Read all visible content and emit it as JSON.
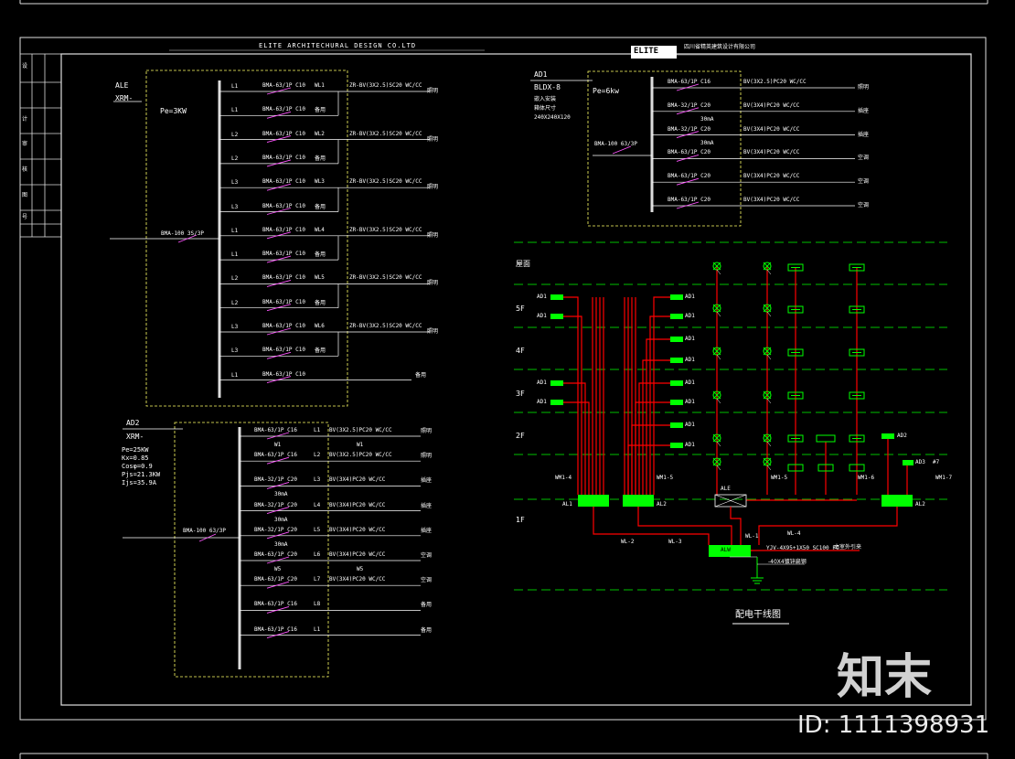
{
  "header": {
    "company_en": "ELITE  ARCHITECHURAL      DESIGN   CO.LTD",
    "logo": "ELITE",
    "company_cn": "四川省精英建筑设计有限公司"
  },
  "title_block": {
    "marks": [
      "设",
      "计",
      "审",
      "核",
      "图",
      "号"
    ]
  },
  "panel_ale": {
    "name": "ALE",
    "model": "XRM-",
    "pe": "Pe=3KW",
    "incoming": "BMA-100 3S/3P",
    "circuits": [
      {
        "phase": "L1",
        "breaker": "BMA-63/1P C10",
        "code": "WL1",
        "cable": "ZR-BV(3X2.5)SC20 WC/CC",
        "load": "照明"
      },
      {
        "phase": "L1",
        "breaker": "BMA-63/1P C10",
        "code": "",
        "cable": "",
        "load": "备用"
      },
      {
        "phase": "L2",
        "breaker": "BMA-63/1P C10",
        "code": "WL2",
        "cable": "ZR-BV(3X2.5)SC20 WC/CC",
        "load": "照明"
      },
      {
        "phase": "L2",
        "breaker": "BMA-63/1P C10",
        "code": "",
        "cable": "",
        "load": "备用"
      },
      {
        "phase": "L3",
        "breaker": "BMA-63/1P C10",
        "code": "WL3",
        "cable": "ZR-BV(3X2.5)SC20 WC/CC",
        "load": "照明"
      },
      {
        "phase": "L3",
        "breaker": "BMA-63/1P C10",
        "code": "",
        "cable": "",
        "load": "备用"
      },
      {
        "phase": "L1",
        "breaker": "BMA-63/1P C10",
        "code": "WL4",
        "cable": "ZR-BV(3X2.5)SC20 WC/CC",
        "load": "照明"
      },
      {
        "phase": "L1",
        "breaker": "BMA-63/1P C10",
        "code": "",
        "cable": "",
        "load": "备用"
      },
      {
        "phase": "L2",
        "breaker": "BMA-63/1P C10",
        "code": "WL5",
        "cable": "ZR-BV(3X2.5)SC20 WC/CC",
        "load": "照明"
      },
      {
        "phase": "L2",
        "breaker": "BMA-63/1P C10",
        "code": "",
        "cable": "",
        "load": "备用"
      },
      {
        "phase": "L3",
        "breaker": "BMA-63/1P C10",
        "code": "WL6",
        "cable": "ZR-BV(3X2.5)SC20 WC/CC",
        "load": "照明"
      },
      {
        "phase": "L3",
        "breaker": "BMA-63/1P C10",
        "code": "",
        "cable": "",
        "load": "备用"
      },
      {
        "phase": "L1",
        "breaker": "BMA-63/1P C10",
        "code": "",
        "cable": "",
        "load": "备用"
      }
    ]
  },
  "panel_ad2": {
    "name": "AD2",
    "model": "XRM-",
    "params": [
      "Pe=25KW",
      "Kx=0.85",
      "Cosφ=0.9",
      "Pjs=21.3KW",
      "Ijs=35.9A"
    ],
    "incoming": "BMA-100 63/3P",
    "circuits": [
      {
        "breaker": "BMA-63/1P C16",
        "phase": "L1",
        "cable": "BV(3X2.5)PC20 WC/CC",
        "load": "照明",
        "note": "W1",
        "note2": "W1"
      },
      {
        "breaker": "BMA-63/1P C16",
        "phase": "L2",
        "cable": "BV(3X2.5)PC20 WC/CC",
        "load": "照明",
        "note": "",
        "note2": ""
      },
      {
        "breaker": "BMA-32/1P C20",
        "phase": "L3",
        "cable": "BV(3X4)PC20 WC/CC",
        "load": "插座",
        "note": "30mA",
        "note2": ""
      },
      {
        "breaker": "BMA-32/1P C20",
        "phase": "L4",
        "cable": "BV(3X4)PC20 WC/CC",
        "load": "插座",
        "note": "30mA",
        "note2": ""
      },
      {
        "breaker": "BMA-32/1P C20",
        "phase": "L5",
        "cable": "BV(3X4)PC20 WC/CC",
        "load": "插座",
        "note": "30mA",
        "note2": ""
      },
      {
        "breaker": "BMA-63/1P C20",
        "phase": "L6",
        "cable": "BV(3X4)PC20 WC/CC",
        "load": "空调",
        "note": "W5",
        "note2": "W5"
      },
      {
        "breaker": "BMA-63/1P C20",
        "phase": "L7",
        "cable": "BV(3X4)PC20 WC/CC",
        "load": "空调",
        "note": "",
        "note2": ""
      },
      {
        "breaker": "BMA-63/1P C16",
        "phase": "L8",
        "cable": "",
        "load": "备用",
        "note": "",
        "note2": ""
      },
      {
        "breaker": "BMA-63/1P C16",
        "phase": "L1",
        "cable": "",
        "load": "备用",
        "note": "",
        "note2": ""
      }
    ]
  },
  "panel_ad1": {
    "name": "AD1",
    "model": "BLDX-8",
    "info": [
      "嵌入安装",
      "箱体尺寸",
      "240X240X120"
    ],
    "pe": "Pe=6kw",
    "incoming": "BMA-100 63/3P",
    "circuits": [
      {
        "breaker": "BMA-63/1P C16",
        "note": "",
        "cable": "BV(3X2.5)PC20 WC/CC",
        "load": "照明"
      },
      {
        "breaker": "BMA-32/1P C20",
        "note": "30mA",
        "cable": "BV(3X4)PC20 WC/CC",
        "load": "插座"
      },
      {
        "breaker": "BMA-32/1P C20",
        "note": "30mA",
        "cable": "BV(3X4)PC20 WC/CC",
        "load": "插座"
      },
      {
        "breaker": "BMA-63/1P C20",
        "note": "",
        "cable": "BV(3X4)PC20 WC/CC",
        "load": "空调"
      },
      {
        "breaker": "BMA-63/1P C20",
        "note": "",
        "cable": "BV(3X4)PC20 WC/CC",
        "load": "空调"
      },
      {
        "breaker": "BMA-63/1P C20",
        "note": "",
        "cable": "BV(3X4)PC20 WC/CC",
        "load": "空调"
      }
    ]
  },
  "riser": {
    "title": "配电干线图",
    "floors": [
      "屋面",
      "5F",
      "4F",
      "3F",
      "2F",
      "1F"
    ],
    "box_label": "AD1",
    "main_boxes": {
      "al1": "AL1",
      "al2": "AL2",
      "ale": "ALE",
      "alw": "ALW",
      "al3": "AL2",
      "ad2": "AD2",
      "ad3": "AD3"
    },
    "feeders": {
      "wm1": "WM1-4",
      "wm2": "WM1-5",
      "wm3": "WM1-6",
      "wm4": "WM1-7",
      "wl": "WL-2",
      "wl3": "WL-3",
      "wl1": "WL-1",
      "wl4": "WL-4",
      "seven": "#7"
    },
    "incoming_note": "YJV-4X95+1X50 SC100 FC",
    "incoming_src": "由室外引来",
    "ground_note": "-40X4镀锌扁钢"
  },
  "watermark": {
    "logo": "知末",
    "id": "ID: 1111398931"
  },
  "colors": {
    "bg": "#000000",
    "pink": "#ff55ff",
    "green": "#00ff00",
    "red": "#ff0000",
    "yellow": "#ffff66",
    "white": "#ffffff"
  }
}
